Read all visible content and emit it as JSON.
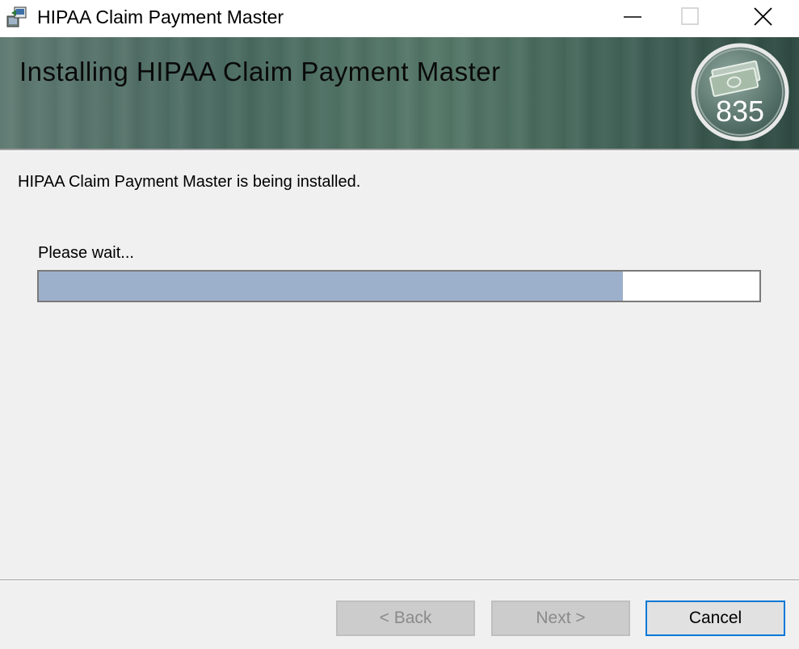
{
  "window": {
    "title": "HIPAA Claim Payment Master"
  },
  "banner": {
    "title": "Installing HIPAA Claim Payment Master",
    "logo_text": "835"
  },
  "body": {
    "status": "HIPAA Claim Payment Master is being installed.",
    "wait_label": "Please wait...",
    "progress_fraction": 0.81
  },
  "footer": {
    "back_label": "< Back",
    "next_label": "Next >",
    "cancel_label": "Cancel"
  },
  "colors": {
    "progress_fill": "#9db0cb",
    "focus_border": "#0078d7"
  }
}
